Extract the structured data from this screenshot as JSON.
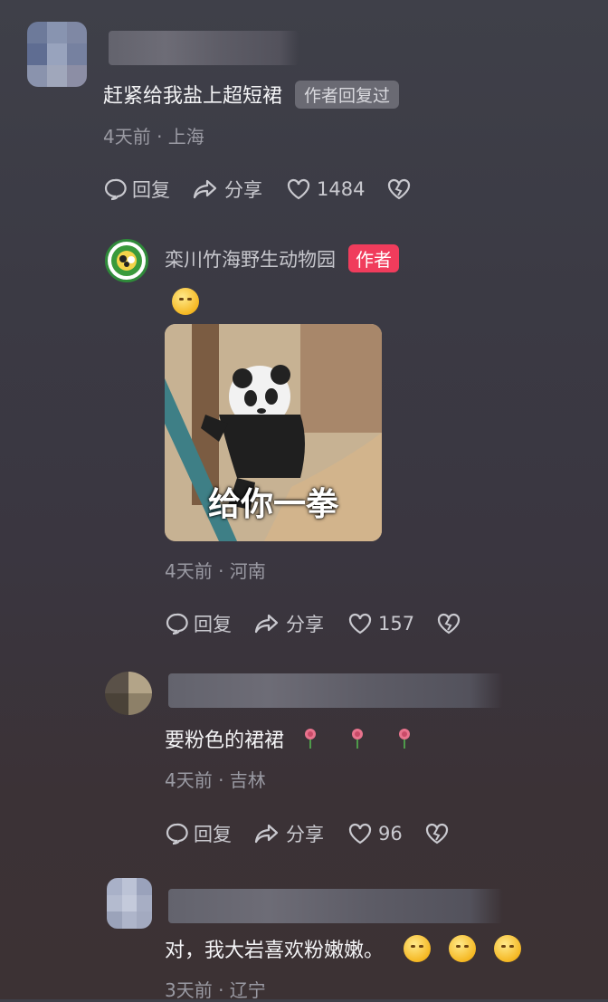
{
  "comments": [
    {
      "text": "赶紧给我盐上超短裙",
      "author_replied_tag": "作者回复过",
      "meta": "4天前 · 上海",
      "actions": {
        "reply": "回复",
        "share": "分享",
        "likes": "1484"
      }
    },
    {
      "author_name": "栾川竹海野生动物园",
      "author_tag": "作者",
      "meme_caption": "给你一拳",
      "meta": "4天前 · 河南",
      "actions": {
        "reply": "回复",
        "share": "分享",
        "likes": "157"
      }
    },
    {
      "text": "要粉色的裙裙",
      "meta": "4天前 · 吉林",
      "actions": {
        "reply": "回复",
        "share": "分享",
        "likes": "96"
      }
    },
    {
      "text": "对，我大岩喜欢粉嫩嫩。",
      "meta": "3天前 · 辽宁"
    }
  ],
  "colors": {
    "author_tag_red": "#f03c5c",
    "meta_gray": "#9a9aa3",
    "text": "#f3f3f5"
  }
}
